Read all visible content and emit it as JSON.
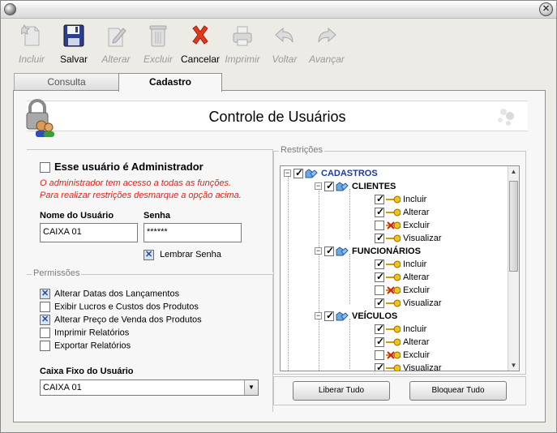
{
  "toolbar": {
    "incluir": "Incluir",
    "salvar": "Salvar",
    "alterar": "Alterar",
    "excluir": "Excluir",
    "cancelar": "Cancelar",
    "imprimir": "Imprimir",
    "voltar": "Voltar",
    "avancar": "Avançar"
  },
  "tabs": {
    "consulta": "Consulta",
    "cadastro": "Cadastro"
  },
  "header": {
    "title": "Controle de Usuários"
  },
  "admin": {
    "checkbox_label": "Esse usuário é Administrador",
    "checked": false,
    "warning_line1": "O administrador tem acesso a todas as funções.",
    "warning_line2": "Para realizar restrições desmarque a opção acima."
  },
  "user": {
    "name_label": "Nome do Usuário",
    "name_value": "CAIXA 01",
    "password_label": "Senha",
    "password_value": "******",
    "remember_label": "Lembrar Senha",
    "remember_checked": true
  },
  "permissoes": {
    "legend": "Permissões",
    "items": [
      {
        "label": "Alterar Datas dos Lançamentos",
        "checked": true
      },
      {
        "label": "Exibir Lucros e Custos dos Produtos",
        "checked": false
      },
      {
        "label": "Alterar Preço de Venda dos Produtos",
        "checked": true
      },
      {
        "label": "Imprimir Relatórios",
        "checked": false
      },
      {
        "label": "Exportar Relatórios",
        "checked": false
      }
    ]
  },
  "caixa": {
    "label": "Caixa Fixo do Usuário",
    "value": "CAIXA 01"
  },
  "restricoes": {
    "legend": "Restrições",
    "root": "CADASTROS",
    "groups": [
      {
        "name": "CLIENTES",
        "actions": [
          "Incluir",
          "Alterar",
          "Excluir",
          "Visualizar"
        ],
        "checked": [
          true,
          true,
          false,
          true
        ]
      },
      {
        "name": "FUNCIONÁRIOS",
        "actions": [
          "Incluir",
          "Alterar",
          "Excluir",
          "Visualizar"
        ],
        "checked": [
          true,
          true,
          false,
          true
        ]
      },
      {
        "name": "VEÍCULOS",
        "actions": [
          "Incluir",
          "Alterar",
          "Excluir",
          "Visualizar"
        ],
        "checked": [
          true,
          true,
          false,
          true
        ]
      }
    ],
    "liberar": "Liberar Tudo",
    "bloquear": "Bloquear Tudo"
  },
  "colors": {
    "warning": "#e0201a",
    "root_node": "#1c3a9c",
    "cancel_icon": "#e03a1e",
    "save_icon": "#2a3f8f"
  }
}
